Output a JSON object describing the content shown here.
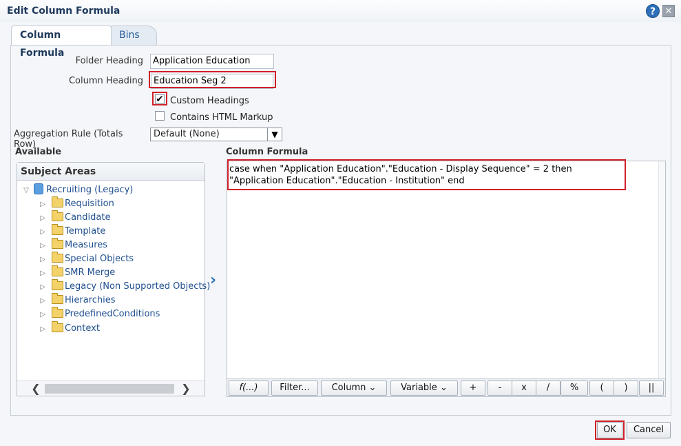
{
  "dialog": {
    "title": "Edit Column Formula",
    "help_glyph": "?",
    "close_glyph": "✕"
  },
  "tabs": [
    {
      "label": "Column Formula",
      "active": true
    },
    {
      "label": "Bins",
      "active": false
    }
  ],
  "form": {
    "folder_heading_label": "Folder Heading",
    "folder_heading_value": "Application Education",
    "column_heading_label": "Column Heading",
    "column_heading_value": "Education Seg 2",
    "custom_headings_label": "Custom Headings",
    "custom_headings_checked": true,
    "contains_html_label": "Contains HTML Markup",
    "contains_html_checked": false,
    "aggregation_label": "Aggregation Rule (Totals Row)",
    "aggregation_value": "Default (None)"
  },
  "available": {
    "section_label": "Available",
    "subject_areas_title": "Subject Areas",
    "root": "Recruiting (Legacy)",
    "folders": [
      "Requisition",
      "Candidate",
      "Template",
      "Measures",
      "Special Objects",
      "SMR Merge",
      "Legacy (Non Supported Objects)",
      "Hierarchies",
      "PredefinedConditions",
      "Context"
    ]
  },
  "formula": {
    "section_label": "Column Formula",
    "text": "case when \"Application Education\".\"Education - Display Sequence\" = 2 then \"Application Education\".\"Education - Institution\" end",
    "toolbar": {
      "func": "f(...)",
      "filter": "Filter...",
      "column": "Column",
      "variable": "Variable",
      "ops": [
        "+",
        "-",
        "x",
        "/",
        "%",
        "(",
        ")",
        "||"
      ]
    }
  },
  "footer": {
    "ok": "OK",
    "cancel": "Cancel"
  },
  "colors": {
    "highlight": "#d0202a",
    "accent": "#2d6fb8"
  }
}
